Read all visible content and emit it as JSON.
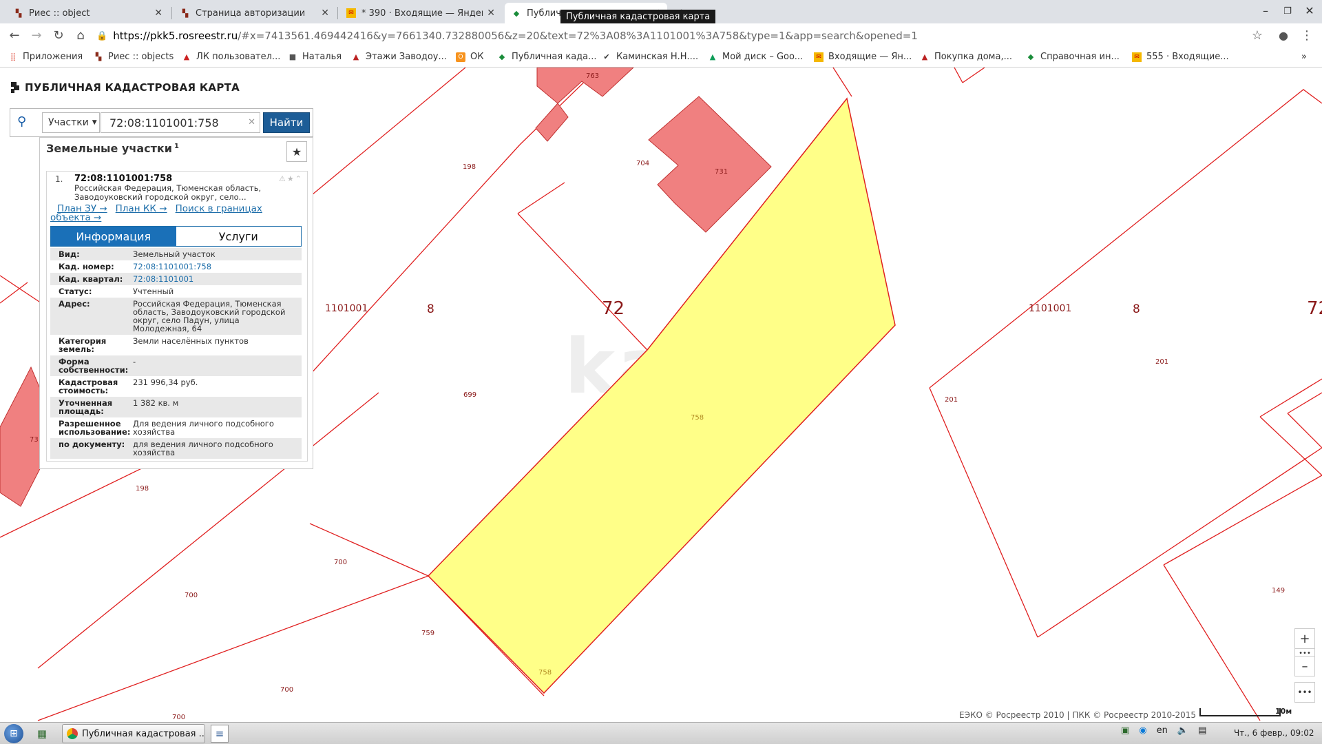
{
  "browser": {
    "tabs": [
      {
        "title": "Риес :: object",
        "icon": "grid-icon"
      },
      {
        "title": "Страница авторизации",
        "icon": "grid-icon"
      },
      {
        "title": "* 390 · Входящие — Яндекс",
        "icon": "mail-icon"
      },
      {
        "title": "Публичная кадастровая карта",
        "icon": "pkk-icon"
      }
    ],
    "tooltip": "Публичная кадастровая карта",
    "url_host": "https://pkk5.rosreestr.ru",
    "url_rest": "/#x=7413561.469442416&y=7661340.732880056&z=20&text=72%3A08%3A1101001%3A758&type=1&app=search&opened=1",
    "bookmarks": [
      "Приложения",
      "Риес :: objects",
      "ЛК пользовател...",
      "Наталья",
      "Этажи Заводоу...",
      "ОК",
      "Публичная када...",
      "Каминская Н.Н....",
      "Мой диск – Goo...",
      "Входящие — Ян...",
      "Покупка дома,...",
      "Справочная ин...",
      "555 · Входящие..."
    ],
    "bookmarks_more": "»"
  },
  "app": {
    "title": "ПУБЛИЧНАЯ КАДАСТРОВАЯ КАРТА",
    "search": {
      "type_label": "Участки",
      "query": "72:08:1101001:758",
      "find_label": "Найти"
    },
    "results": {
      "heading": "Земельные участки",
      "count": "1",
      "item_number": "1.",
      "cad_number": "72:08:1101001:758",
      "address_short": "Российская Федерация, Тюменская область, Заводоуковский городской округ, село...",
      "links": [
        "План ЗУ →",
        "План КК →",
        "Поиск в границах объекта →"
      ],
      "tabs": [
        "Информация",
        "Услуги"
      ],
      "info": [
        {
          "k": "Вид:",
          "v": "Земельный участок"
        },
        {
          "k": "Кад. номер:",
          "v": "72:08:1101001:758",
          "link": true
        },
        {
          "k": "Кад. квартал:",
          "v": "72:08:1101001",
          "link": true
        },
        {
          "k": "Статус:",
          "v": "Учтенный"
        },
        {
          "k": "Адрес:",
          "v": "Российская Федерация, Тюменская область, Заводоуковский городской округ, село Падун, улица Молодежная, 64"
        },
        {
          "k": "Категория земель:",
          "v": "Земли населённых пунктов"
        },
        {
          "k": "Форма собственности:",
          "v": "-"
        },
        {
          "k": "Кадастровая стоимость:",
          "v": "231 996,34 руб."
        },
        {
          "k": "Уточненная площадь:",
          "v": "1 382 кв. м"
        },
        {
          "k": "Разрешенное использование:",
          "v": "Для ведения личного подсобного хозяйства"
        },
        {
          "k": "по документу:",
          "v": "для ведения личного подсобного хозяйства"
        }
      ]
    }
  },
  "map": {
    "labels": {
      "quarter_left": "1101001",
      "district_left": "8",
      "region_left": "72",
      "quarter_right": "1101001",
      "district_right": "8",
      "region_right": "72",
      "p763": "763",
      "p198a": "198",
      "p704": "704",
      "p731": "731",
      "p699": "699",
      "p758a": "758",
      "p758b": "758",
      "p198b": "198",
      "p700a": "700",
      "p700b": "700",
      "p700c": "700",
      "p700d": "700",
      "p759": "759",
      "p201a": "201",
      "p201b": "201",
      "p149": "149",
      "p73": "73"
    },
    "watermark": "kagi",
    "attribution": "ЕЭКО © Росреестр 2010 | ПКК © Росреестр 2010-2015",
    "scale": "10м",
    "colors": {
      "selected": "#ffff88",
      "building": "#f08080",
      "boundary": "#e02020"
    }
  },
  "taskbar": {
    "item": "Публичная кадастровая ...",
    "lang": "en",
    "clock": "Чт., 6 февр., 09:02"
  }
}
